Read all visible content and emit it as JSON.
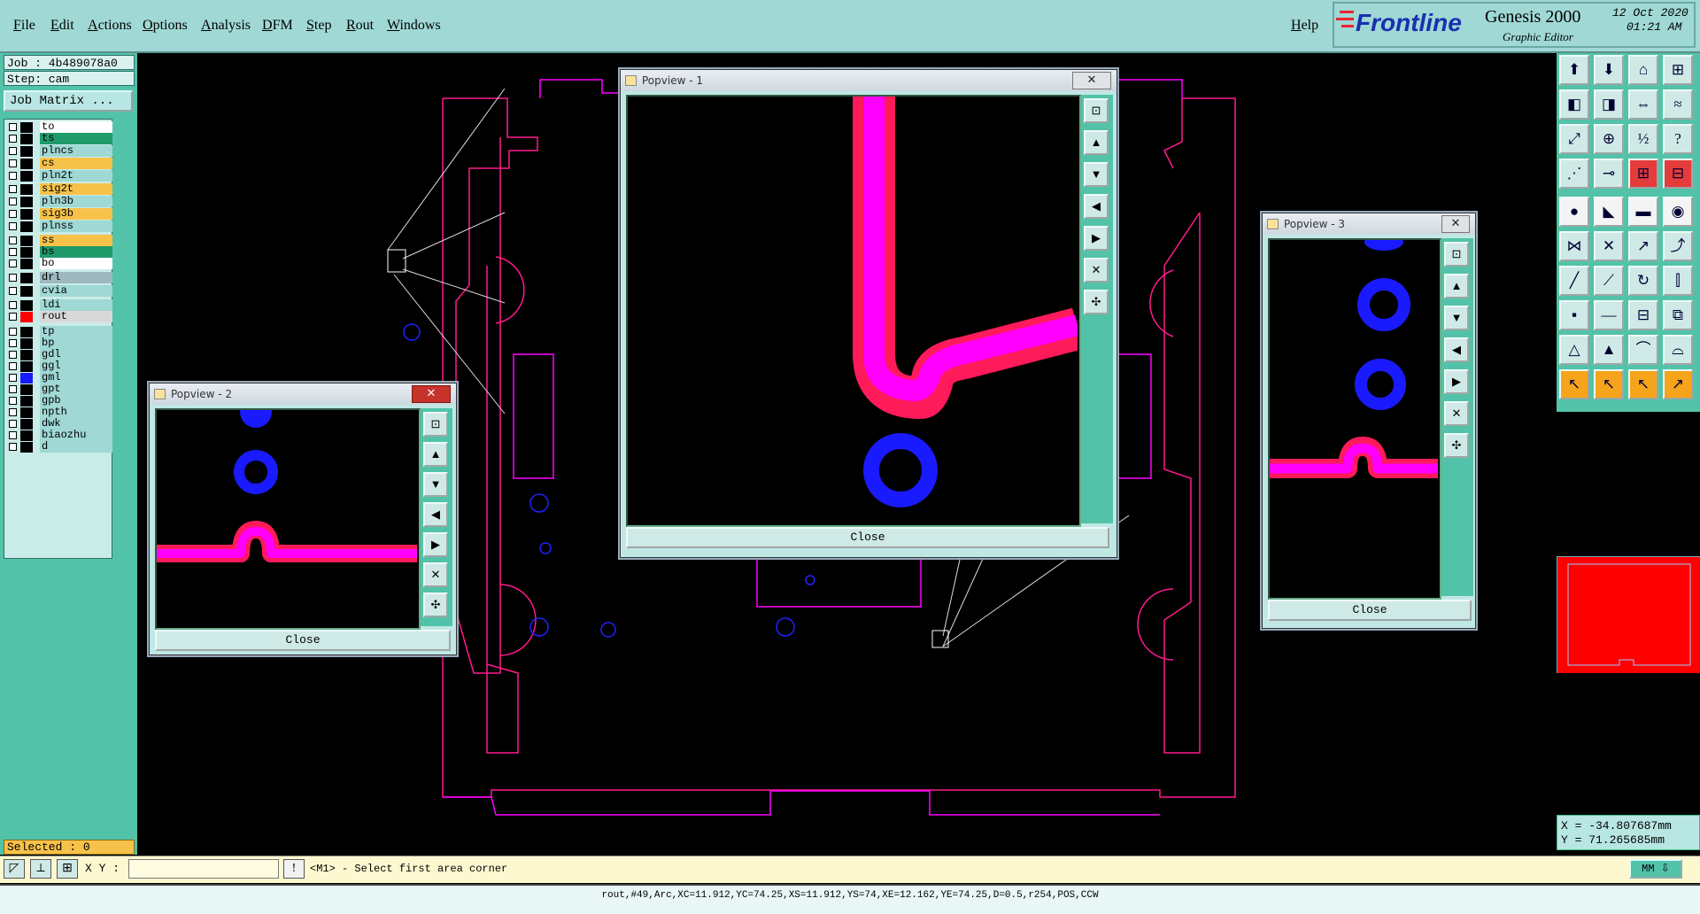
{
  "menubar": {
    "items": [
      "File",
      "Edit",
      "Actions",
      "Options",
      "Analysis",
      "DFM",
      "Step",
      "Rout",
      "Windows"
    ],
    "help": "Help"
  },
  "brand": {
    "logo": "Frontline",
    "product": "Genesis 2000",
    "subtitle": "Graphic Editor",
    "date": "12 Oct 2020",
    "time": "01:21 AM"
  },
  "job": {
    "job_label": "Job : 4b489078a0",
    "step_label": "Step: cam",
    "matrix_button": "Job Matrix ..."
  },
  "layers": [
    {
      "name": "to",
      "color": "#ffffff",
      "swatch": "#000000"
    },
    {
      "name": "ts",
      "color": "#1f9a6a",
      "swatch": "#000000"
    },
    {
      "name": "plncs",
      "color": "#9fd8d4",
      "swatch": "#000000"
    },
    {
      "name": "cs",
      "color": "#f7c24a",
      "swatch": "#000000"
    },
    {
      "name": "pln2t",
      "color": "#9fd8d4",
      "swatch": "#000000"
    },
    {
      "name": "sig2t",
      "color": "#f7c24a",
      "swatch": "#000000"
    },
    {
      "name": "pln3b",
      "color": "#9fd8d4",
      "swatch": "#000000"
    },
    {
      "name": "sig3b",
      "color": "#f7c24a",
      "swatch": "#000000"
    },
    {
      "name": "plnss",
      "color": "#9fd8d4",
      "swatch": "#000000"
    },
    {
      "name": "ss",
      "color": "#f7c24a",
      "swatch": "#000000"
    },
    {
      "name": "bs",
      "color": "#1f9a6a",
      "swatch": "#000000"
    },
    {
      "name": "bo",
      "color": "#ffffff",
      "swatch": "#000000"
    },
    {
      "name": "drl",
      "color": "#9fb8c0",
      "swatch": "#000000"
    },
    {
      "name": "cvia",
      "color": "#9fd8d4",
      "swatch": "#000000"
    },
    {
      "name": "ldi",
      "color": "#9fd8d4",
      "swatch": "#000000"
    },
    {
      "name": "rout",
      "color": "#d8d8d8",
      "swatch": "#ff0000"
    },
    {
      "name": "tp",
      "color": "#9fd8d4",
      "swatch": "#000000"
    },
    {
      "name": "bp",
      "color": "#9fd8d4",
      "swatch": "#000000"
    },
    {
      "name": "gdl",
      "color": "#9fd8d4",
      "swatch": "#000000"
    },
    {
      "name": "ggl",
      "color": "#9fd8d4",
      "swatch": "#000000"
    },
    {
      "name": "gml",
      "color": "#9fd8d4",
      "swatch": "#1a1aff"
    },
    {
      "name": "gpt",
      "color": "#9fd8d4",
      "swatch": "#000000"
    },
    {
      "name": "gpb",
      "color": "#9fd8d4",
      "swatch": "#000000"
    },
    {
      "name": "npth",
      "color": "#9fd8d4",
      "swatch": "#000000"
    },
    {
      "name": "dwk",
      "color": "#9fd8d4",
      "swatch": "#000000"
    },
    {
      "name": "biaozhu",
      "color": "#9fd8d4",
      "swatch": "#000000"
    },
    {
      "name": "d",
      "color": "#9fd8d4",
      "swatch": "#000000"
    }
  ],
  "selected_label": "Selected : 0",
  "command": {
    "xy_label": "X Y :",
    "prompt": "<M1> - Select first area corner",
    "units": "MM"
  },
  "status_text": "rout,#49,Arc,XC=11.912,YC=74.25,XS=11.912,YS=74,XE=12.162,YE=74.25,D=0.5,r254,POS,CCW",
  "coords": {
    "x": "X = -34.807687mm",
    "y": "Y = 71.265685mm"
  },
  "popviews": {
    "p1": {
      "title": "Popview - 1",
      "close": "Close"
    },
    "p2": {
      "title": "Popview - 2",
      "close": "Close"
    },
    "p3": {
      "title": "Popview - 3",
      "close": "Close"
    }
  },
  "colors": {
    "panel_teal": "#52c3a8",
    "menu_bg": "#9fd8d4",
    "rout_line": "#ff1a8c",
    "outline_magenta": "#ff00ff",
    "pad_blue": "#1a1aff"
  }
}
